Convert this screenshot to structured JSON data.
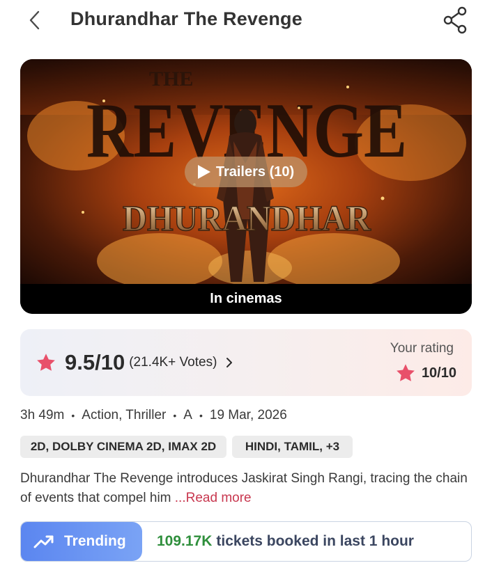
{
  "header": {
    "title": "Dhurandhar The Revenge",
    "back_icon": "chevron-left-icon",
    "share_icon": "share-icon"
  },
  "poster": {
    "title_top": "THE",
    "title_big": "REVENGE",
    "title_logo": "DHURANDHAR",
    "trailers_label": "Trailers (10)",
    "status_label": "In cinemas"
  },
  "rating": {
    "score": "9.5/10",
    "votes": "(21.4K+ Votes)",
    "your_rating_label": "Your rating",
    "your_rating_value": "10/10",
    "star_color": "#e8506a"
  },
  "meta": {
    "duration": "3h 49m",
    "genres": "Action, Thriller",
    "certificate": "A",
    "release_date": "19 Mar, 2026"
  },
  "tags": {
    "formats": "2D, DOLBY CINEMA 2D, IMAX 2D",
    "languages": "HINDI, TAMIL,  +3"
  },
  "description": {
    "text": "Dhurandhar The Revenge introduces Jaskirat Singh Rangi, tracing the chain of events that compel him ",
    "read_more": "...Read more"
  },
  "trending": {
    "label": "Trending",
    "count": "109.17K",
    "text": "tickets booked in last 1 hour"
  },
  "colors": {
    "accent_red": "#c8374f",
    "trending_blue": "#5b86f0",
    "trending_green": "#2f8f3c"
  }
}
